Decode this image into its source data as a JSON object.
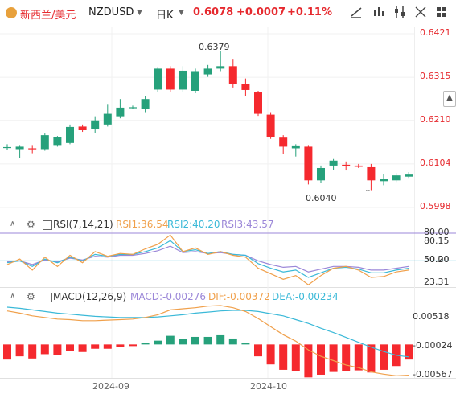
{
  "header": {
    "symbol_cn": "新西兰/美元",
    "symbol": "NZDUSD",
    "symbol_dropdown_icon": "caret-down-icon",
    "period": "日K",
    "period_dropdown_icon": "caret-down-icon",
    "price": "0.6078",
    "change": "+0.0007",
    "change_pct": "+0.11%",
    "tools": [
      "line-drawing-icon",
      "indicator-bars-icon",
      "settings-sliders-icon",
      "fullscreen-icon",
      "grid-layout-icon"
    ]
  },
  "colors": {
    "up": "#26a17b",
    "down": "#f5292e",
    "accent_orange": "#f0a04b",
    "accent_teal": "#3bb9d8",
    "accent_purple": "#9b87d8",
    "price_red": "#e6292e"
  },
  "main_chart": {
    "price_axis": [
      "0.6421",
      "0.6315",
      "0.6210",
      "0.6104",
      "0.5998"
    ],
    "price_axis_values": [
      0.6421,
      0.6315,
      0.621,
      0.6104,
      0.5998
    ],
    "high_label": "0.6379",
    "low_label": "0.6040",
    "collapse_icon": "chevron-up-icon"
  },
  "rsi": {
    "title": "RSI(7,14,21)",
    "rsi1": "RSI1:36.54",
    "rsi2": "RSI2:40.20",
    "rsi3": "RSI3:43.57",
    "axis": [
      "80.00",
      "80.15",
      "50.00",
      "50.20",
      "23.31"
    ]
  },
  "macd": {
    "title": "MACD(12,26,9)",
    "macd": "MACD:-0.00276",
    "dif": "DIF:-0.00372",
    "dea": "DEA:-0.00234",
    "axis": [
      "0.00518",
      "-0.00024",
      "-0.00567"
    ]
  },
  "time_axis": [
    "2024-09",
    "2024-10"
  ],
  "chart_data": {
    "type": "candlestick",
    "candles": [
      {
        "o": 0.6145,
        "h": 0.6152,
        "l": 0.6138,
        "c": 0.6145
      },
      {
        "o": 0.614,
        "h": 0.615,
        "l": 0.6118,
        "c": 0.6146
      },
      {
        "o": 0.6142,
        "h": 0.615,
        "l": 0.613,
        "c": 0.6141
      },
      {
        "o": 0.614,
        "h": 0.6178,
        "l": 0.6136,
        "c": 0.6174
      },
      {
        "o": 0.615,
        "h": 0.6172,
        "l": 0.6146,
        "c": 0.617
      },
      {
        "o": 0.6155,
        "h": 0.62,
        "l": 0.6152,
        "c": 0.6194
      },
      {
        "o": 0.6195,
        "h": 0.62,
        "l": 0.6182,
        "c": 0.6186
      },
      {
        "o": 0.6188,
        "h": 0.622,
        "l": 0.618,
        "c": 0.621
      },
      {
        "o": 0.62,
        "h": 0.625,
        "l": 0.6195,
        "c": 0.6226
      },
      {
        "o": 0.622,
        "h": 0.6262,
        "l": 0.6215,
        "c": 0.6241
      },
      {
        "o": 0.624,
        "h": 0.6246,
        "l": 0.6238,
        "c": 0.6242
      },
      {
        "o": 0.6238,
        "h": 0.627,
        "l": 0.623,
        "c": 0.6262
      },
      {
        "o": 0.6285,
        "h": 0.634,
        "l": 0.628,
        "c": 0.6336
      },
      {
        "o": 0.6336,
        "h": 0.6342,
        "l": 0.6278,
        "c": 0.6285
      },
      {
        "o": 0.6285,
        "h": 0.6342,
        "l": 0.6278,
        "c": 0.6331
      },
      {
        "o": 0.6282,
        "h": 0.6336,
        "l": 0.6276,
        "c": 0.633
      },
      {
        "o": 0.6322,
        "h": 0.6345,
        "l": 0.6316,
        "c": 0.6336
      },
      {
        "o": 0.6336,
        "h": 0.6379,
        "l": 0.633,
        "c": 0.6342
      },
      {
        "o": 0.6342,
        "h": 0.636,
        "l": 0.629,
        "c": 0.6298
      },
      {
        "o": 0.6298,
        "h": 0.6312,
        "l": 0.627,
        "c": 0.6284
      },
      {
        "o": 0.6278,
        "h": 0.6282,
        "l": 0.6221,
        "c": 0.6226
      },
      {
        "o": 0.6224,
        "h": 0.623,
        "l": 0.6165,
        "c": 0.617
      },
      {
        "o": 0.6168,
        "h": 0.6174,
        "l": 0.6128,
        "c": 0.6146
      },
      {
        "o": 0.6142,
        "h": 0.6152,
        "l": 0.6122,
        "c": 0.6149
      },
      {
        "o": 0.6146,
        "h": 0.615,
        "l": 0.6054,
        "c": 0.6064
      },
      {
        "o": 0.6064,
        "h": 0.61,
        "l": 0.6058,
        "c": 0.6094
      },
      {
        "o": 0.61,
        "h": 0.6116,
        "l": 0.609,
        "c": 0.6112
      },
      {
        "o": 0.6102,
        "h": 0.611,
        "l": 0.6088,
        "c": 0.6101
      },
      {
        "o": 0.61,
        "h": 0.6104,
        "l": 0.6094,
        "c": 0.6097
      },
      {
        "o": 0.6096,
        "h": 0.6104,
        "l": 0.604,
        "c": 0.6064
      },
      {
        "o": 0.6062,
        "h": 0.608,
        "l": 0.6052,
        "c": 0.6068
      },
      {
        "o": 0.6064,
        "h": 0.6082,
        "l": 0.606,
        "c": 0.6076
      },
      {
        "o": 0.6073,
        "h": 0.6084,
        "l": 0.607,
        "c": 0.6078
      }
    ],
    "rsi_ylim": [
      23.31,
      80.0
    ],
    "rsi1": [
      46,
      52,
      40,
      54,
      44,
      56,
      48,
      60,
      55,
      58,
      57,
      63,
      68,
      78,
      60,
      64,
      57,
      60,
      56,
      54,
      42,
      36,
      30,
      34,
      24,
      34,
      42,
      44,
      40,
      32,
      33,
      38,
      40
    ],
    "rsi2": [
      48,
      50,
      44,
      52,
      48,
      54,
      50,
      57,
      55,
      57,
      57,
      60,
      64,
      72,
      60,
      62,
      58,
      60,
      57,
      56,
      47,
      42,
      38,
      40,
      32,
      37,
      42,
      43,
      41,
      37,
      37,
      40,
      42
    ],
    "rsi3": [
      49,
      50,
      46,
      51,
      49,
      53,
      51,
      55,
      54,
      56,
      56,
      58,
      61,
      66,
      59,
      60,
      58,
      59,
      57,
      56,
      50,
      46,
      43,
      44,
      38,
      41,
      44,
      44,
      43,
      40,
      40,
      42,
      44
    ],
    "macd_ylim": [
      -0.0062,
      0.0072
    ],
    "macd_hist": [
      -0.0028,
      -0.0022,
      -0.0026,
      -0.0018,
      -0.002,
      -0.0012,
      -0.0014,
      -0.0008,
      -0.0008,
      -0.0004,
      -0.0003,
      0.0003,
      0.0007,
      0.0016,
      0.001,
      0.0014,
      0.0014,
      0.0017,
      0.0011,
      0.0002,
      -0.0022,
      -0.0037,
      -0.0047,
      -0.005,
      -0.0061,
      -0.0056,
      -0.0051,
      -0.0049,
      -0.0048,
      -0.0052,
      -0.0047,
      -0.004,
      -0.0028
    ],
    "dif": [
      0.0062,
      0.0058,
      0.0053,
      0.005,
      0.0047,
      0.0046,
      0.0044,
      0.0044,
      0.0045,
      0.0046,
      0.0047,
      0.005,
      0.0055,
      0.0064,
      0.0066,
      0.0068,
      0.0071,
      0.0072,
      0.0068,
      0.0061,
      0.0048,
      0.0033,
      0.0018,
      0.0006,
      -0.001,
      -0.0022,
      -0.003,
      -0.0038,
      -0.0043,
      -0.0051,
      -0.0055,
      -0.0058,
      -0.0057
    ],
    "dea": [
      0.0069,
      0.0067,
      0.0064,
      0.0061,
      0.0058,
      0.0056,
      0.0054,
      0.0052,
      0.0051,
      0.005,
      0.005,
      0.005,
      0.0051,
      0.0053,
      0.0055,
      0.0058,
      0.006,
      0.0062,
      0.0063,
      0.0063,
      0.0061,
      0.0057,
      0.0053,
      0.0046,
      0.0039,
      0.003,
      0.0022,
      0.0013,
      0.0004,
      -0.0005,
      -0.0013,
      -0.002,
      -0.0023
    ],
    "x_ticks": [
      "2024-09",
      "2024-10"
    ]
  }
}
